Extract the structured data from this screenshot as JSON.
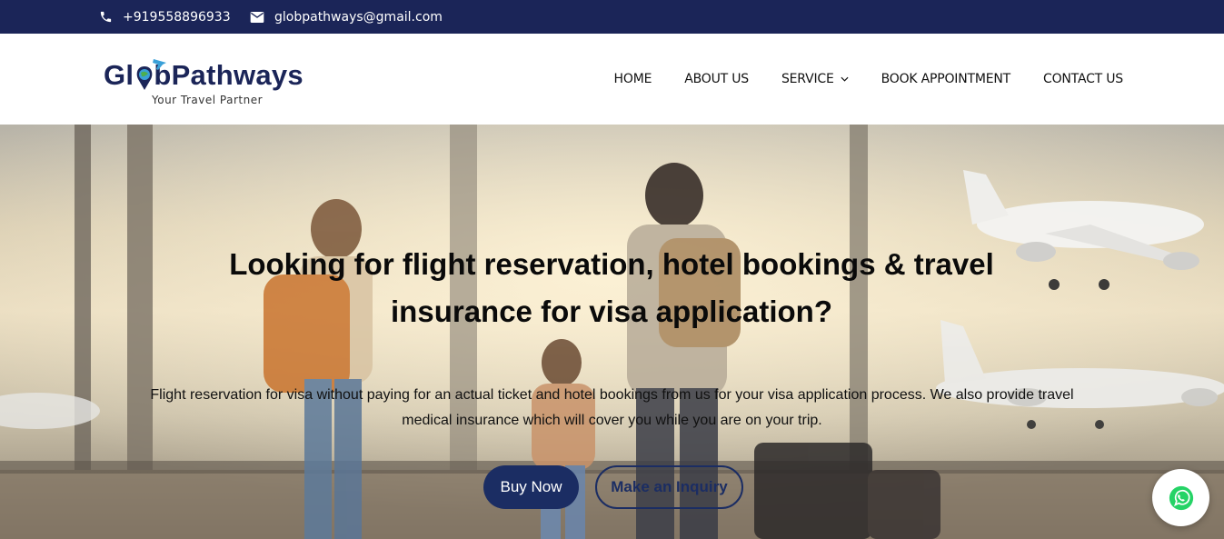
{
  "topbar": {
    "phone": "+919558896933",
    "email": "globpathways@gmail.com"
  },
  "logo": {
    "name_part1": "Gl",
    "name_part2": "bPathways",
    "tagline": "Your Travel Partner"
  },
  "nav": {
    "items": [
      {
        "label": "HOME"
      },
      {
        "label": "ABOUT US"
      },
      {
        "label": "SERVICE"
      },
      {
        "label": "BOOK APPOINTMENT"
      },
      {
        "label": "CONTACT US"
      }
    ]
  },
  "hero": {
    "title": "Looking for flight reservation, hotel bookings & travel insurance for visa application?",
    "subtitle": "Flight reservation for visa without paying for an actual ticket and hotel bookings from us for your visa application process. We also provide travel medical insurance which will cover you while you are on your trip.",
    "buy_label": "Buy Now",
    "inquiry_label": "Make an Inquiry"
  },
  "icons": {
    "phone": "phone-icon",
    "email": "mail-icon",
    "caret": "chevron-down-icon",
    "whatsapp": "whatsapp-icon"
  },
  "colors": {
    "topbar": "#1b2558",
    "primary": "#1b2d63",
    "whatsapp": "#25d366"
  }
}
